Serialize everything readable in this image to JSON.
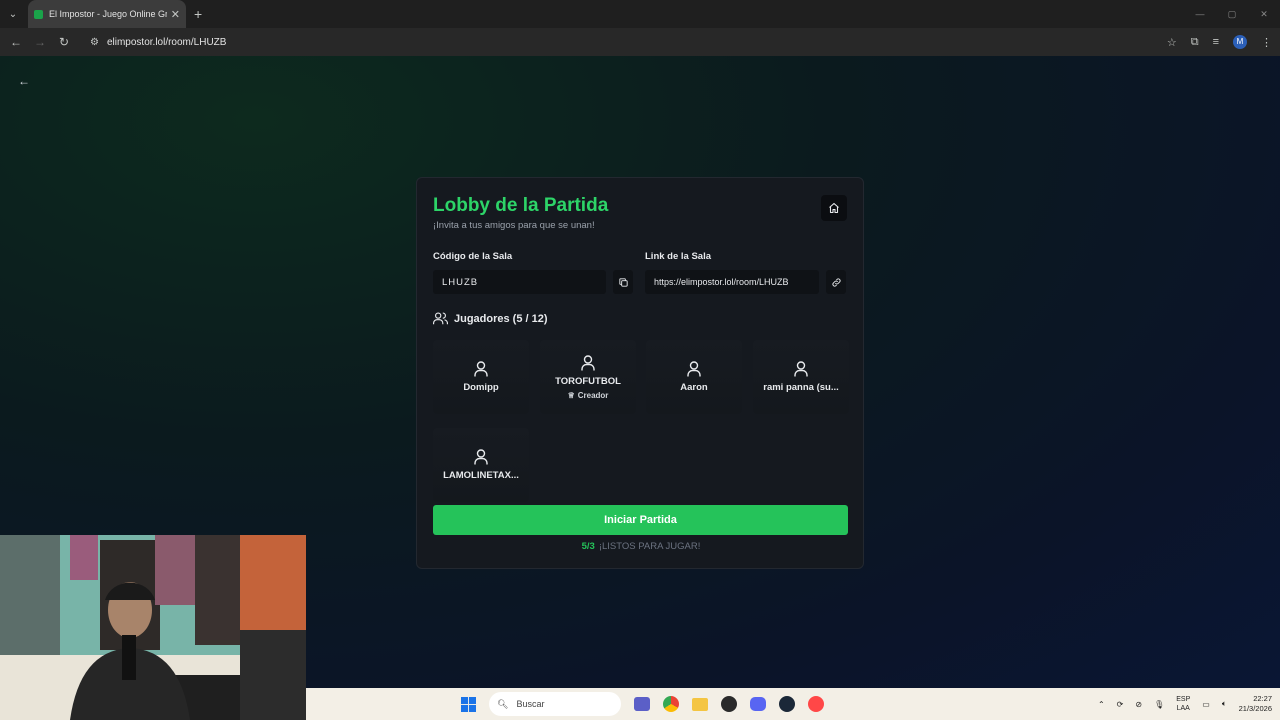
{
  "browser": {
    "tab_title": "El Impostor - Juego Online Gra",
    "url": "elimpostor.lol/room/LHUZB"
  },
  "lobby": {
    "title": "Lobby de la Partida",
    "subtitle": "¡Invita a tus amigos para que se unan!",
    "code_label": "Código de la Sala",
    "code_value": "LHUZB",
    "link_label": "Link de la Sala",
    "link_value": "https://elimpostor.lol/room/LHUZB",
    "players_label": "Jugadores (5 / 12)",
    "players": [
      {
        "name": "Domipp",
        "role": ""
      },
      {
        "name": "TOROFUTBOL",
        "role": "Creador"
      },
      {
        "name": "Aaron",
        "role": ""
      },
      {
        "name": "rami panna (su...",
        "role": ""
      },
      {
        "name": "LAMOLINETAX...",
        "role": ""
      }
    ],
    "start_button": "Iniciar Partida",
    "ready_count": "5/3",
    "ready_text": "¡LISTOS PARA JUGAR!"
  },
  "taskbar": {
    "search_placeholder": "Buscar",
    "lang_1": "ESP",
    "lang_2": "LAA",
    "time": "22:27",
    "date": "21/3/2026"
  },
  "colors": {
    "accent": "#25c35a",
    "title_green": "#2dd468",
    "card_bg": "#15191f"
  }
}
